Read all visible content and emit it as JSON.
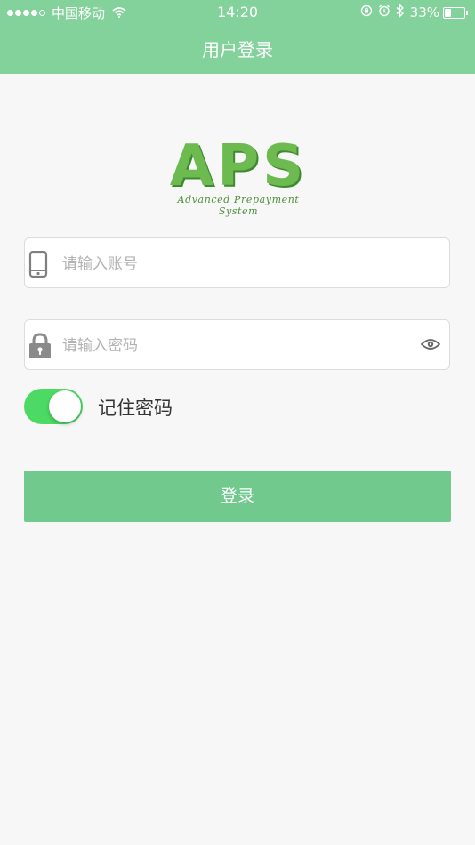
{
  "status_bar": {
    "signal_dots_filled": 4,
    "signal_dots_total": 5,
    "carrier": "中国移动",
    "time": "14:20",
    "battery_pct": "33%",
    "battery_level": 0.33,
    "icons": [
      "wifi-icon",
      "orientation-lock-icon",
      "alarm-icon",
      "bluetooth-icon",
      "battery-icon"
    ]
  },
  "header": {
    "title": "用户登录",
    "color": "#84d29b"
  },
  "logo": {
    "main": "APS",
    "sub": "Advanced Prepayment System",
    "color": "#6dbb50"
  },
  "form": {
    "account": {
      "placeholder": "请输入账号",
      "value": "",
      "icon": "phone-icon"
    },
    "password": {
      "placeholder": "请输入密码",
      "value": "",
      "icon": "lock-icon",
      "reveal_icon": "eye-icon"
    },
    "remember": {
      "label": "记住密码",
      "checked": true,
      "color": "#4cd964"
    },
    "submit_label": "登录",
    "submit_color": "#72c98e"
  }
}
